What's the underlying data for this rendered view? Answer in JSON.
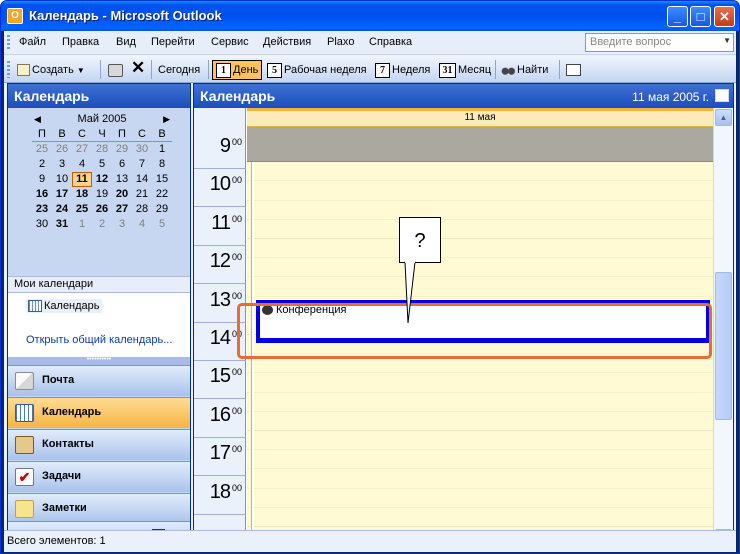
{
  "window": {
    "title": "Календарь - Microsoft Outlook",
    "app_icon": "O"
  },
  "menu": [
    "Файл",
    "Правка",
    "Вид",
    "Перейти",
    "Сервис",
    "Действия",
    "Plaxo",
    "Справка"
  ],
  "ask": {
    "placeholder": "Введите вопрос"
  },
  "toolbar": {
    "create": "Создать",
    "today": "Сегодня",
    "day": "День",
    "day_icon": "1",
    "workweek": "Рабочая неделя",
    "workweek_icon": "5",
    "week": "Неделя",
    "week_icon": "7",
    "month": "Месяц",
    "month_icon": "31",
    "find": "Найти"
  },
  "nav": {
    "title": "Календарь",
    "minical": {
      "month": "Май 2005",
      "weekdays": [
        "П",
        "В",
        "С",
        "Ч",
        "П",
        "С",
        "В"
      ],
      "rows": [
        [
          "25",
          "26",
          "27",
          "28",
          "29",
          "30",
          "1"
        ],
        [
          "2",
          "3",
          "4",
          "5",
          "6",
          "7",
          "8"
        ],
        [
          "9",
          "10",
          "11",
          "12",
          "13",
          "14",
          "15"
        ],
        [
          "16",
          "17",
          "18",
          "19",
          "20",
          "21",
          "22"
        ],
        [
          "23",
          "24",
          "25",
          "26",
          "27",
          "28",
          "29"
        ],
        [
          "30",
          "31",
          "1",
          "2",
          "3",
          "4",
          "5"
        ]
      ],
      "today": "11"
    },
    "my_calendars": "Мои календари",
    "calendar_item": "Календарь",
    "open_shared": "Открыть общий календарь...",
    "buttons": [
      "Почта",
      "Календарь",
      "Контакты",
      "Задачи",
      "Заметки"
    ]
  },
  "main": {
    "title": "Календарь",
    "date": "11 мая 2005 г.",
    "day_header": "11 мая",
    "hours": [
      "9",
      "10",
      "11",
      "12",
      "13",
      "14",
      "15",
      "16",
      "17",
      "18"
    ],
    "minutes": "00",
    "appointment": "Конференция",
    "callout": "?"
  },
  "status": "Всего элементов: 1",
  "colors": {
    "accent": "#0053ee",
    "today_border": "#c45a00",
    "highlight": "#e86c3a",
    "appointment_border": "#0000e0"
  }
}
